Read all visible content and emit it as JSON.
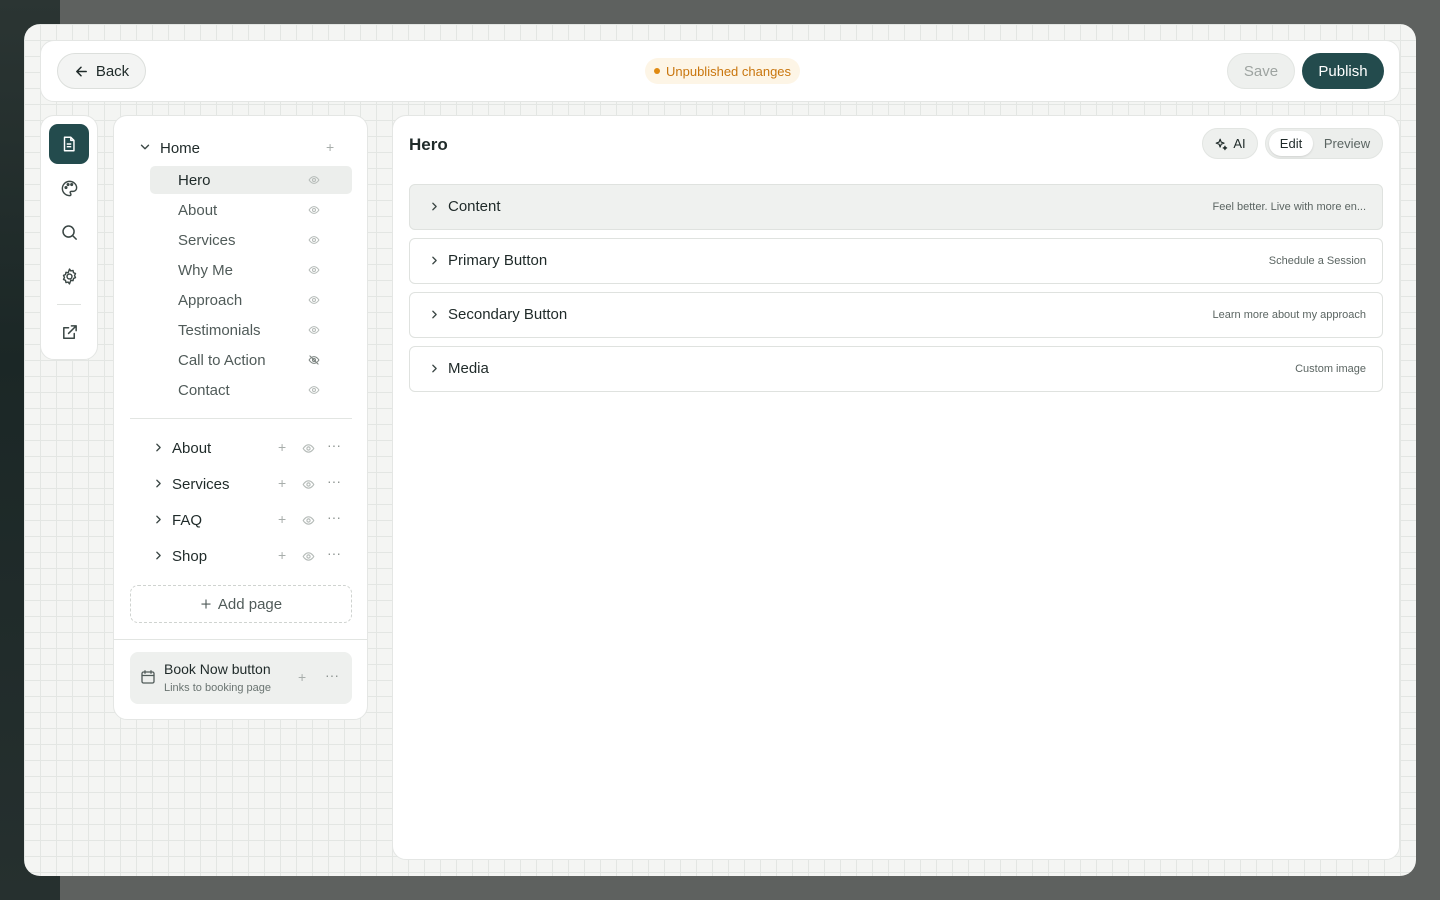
{
  "topbar": {
    "back_label": "Back",
    "status_label": "Unpublished changes",
    "save_label": "Save",
    "publish_label": "Publish"
  },
  "rail": {
    "items": [
      {
        "icon": "document-icon",
        "active": true
      },
      {
        "icon": "palette-icon",
        "active": false
      },
      {
        "icon": "search-icon",
        "active": false
      },
      {
        "icon": "gear-icon",
        "active": false
      },
      {
        "icon": "external-link-icon",
        "active": false
      }
    ]
  },
  "sidebar": {
    "home": {
      "label": "Home",
      "add": "+",
      "sections": [
        {
          "label": "Hero",
          "visible": true,
          "active": true
        },
        {
          "label": "About",
          "visible": true
        },
        {
          "label": "Services",
          "visible": true
        },
        {
          "label": "Why Me",
          "visible": true
        },
        {
          "label": "Approach",
          "visible": true
        },
        {
          "label": "Testimonials",
          "visible": true
        },
        {
          "label": "Call to Action",
          "visible": false
        },
        {
          "label": "Contact",
          "visible": true
        }
      ]
    },
    "pages": [
      {
        "label": "About"
      },
      {
        "label": "Services"
      },
      {
        "label": "FAQ"
      },
      {
        "label": "Shop"
      }
    ],
    "add_page_label": "Add page",
    "book_now": {
      "title": "Book Now button",
      "subtitle": "Links to booking page"
    }
  },
  "main": {
    "title": "Hero",
    "ai_label": "AI",
    "mode": {
      "edit_label": "Edit",
      "preview_label": "Preview",
      "selected": "Edit"
    },
    "fields": [
      {
        "label": "Content",
        "summary": "Feel better. Live with more en...",
        "highlighted": true
      },
      {
        "label": "Primary Button",
        "summary": "Schedule a Session"
      },
      {
        "label": "Secondary Button",
        "summary": "Learn more about my approach"
      },
      {
        "label": "Media",
        "summary": "Custom image"
      }
    ]
  },
  "colors": {
    "accent": "#234b4d",
    "status_warning": "#e08a12"
  }
}
